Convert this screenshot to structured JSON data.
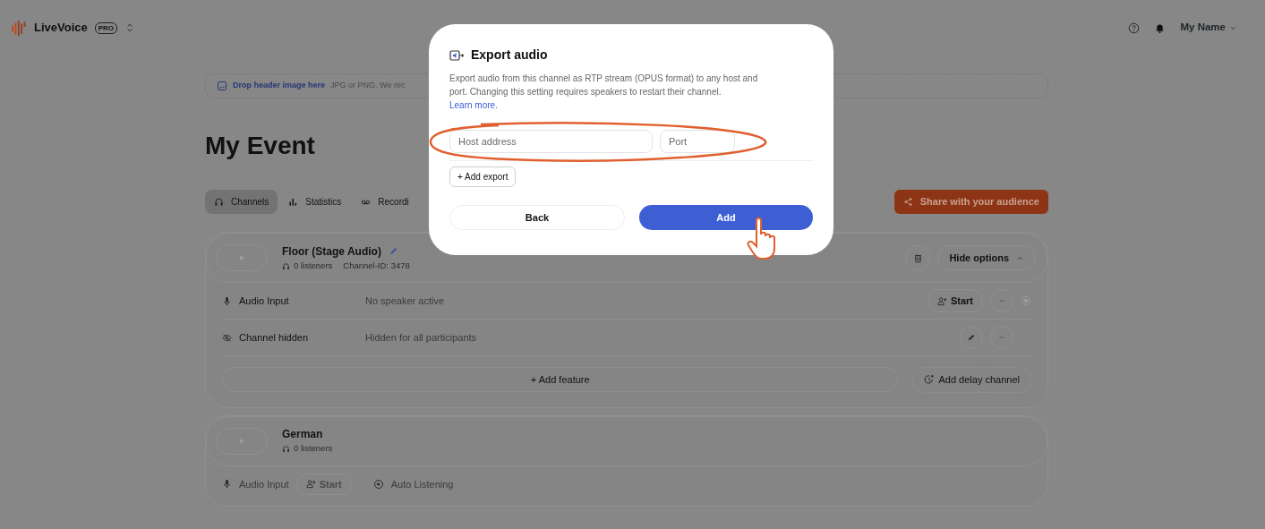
{
  "app": {
    "name": "LiveVoice",
    "badge": "PRO"
  },
  "user": {
    "name": "My Name"
  },
  "drop_zone": {
    "link": "Drop header image here",
    "hint": "JPG or PNG. We rec"
  },
  "title": "My Event",
  "tabs": [
    {
      "kind": "channels",
      "label": "Channels",
      "selected": true
    },
    {
      "kind": "statistics",
      "label": "Statistics",
      "selected": false
    },
    {
      "kind": "recordings",
      "label": "Recordi",
      "selected": false
    }
  ],
  "share_button": "Share with your audience",
  "channels": [
    {
      "name": "Floor (Stage Audio)",
      "listeners": "0 listeners",
      "channel_id": "Channel-ID: 3478",
      "expanded": true,
      "options_button": "Hide options",
      "features": [
        {
          "kind": "audio_input",
          "label": "Audio Input",
          "value": "No speaker active",
          "action": "Start"
        },
        {
          "kind": "hidden",
          "label": "Channel hidden",
          "value": "Hidden for all participants"
        }
      ],
      "add_feature": "+ Add feature",
      "add_delay": "Add delay channel"
    },
    {
      "name": "German",
      "listeners": "0 listeners",
      "expanded": false,
      "input_label": "Audio Input",
      "action": "Start",
      "auto_listening": "Auto Listening"
    }
  ],
  "dialog": {
    "title": "Export audio",
    "description": "Export audio from this channel as RTP stream (OPUS format) to any host and port. Changing this setting requires speakers to restart their channel.",
    "link": "Learn more.",
    "host_placeholder": "Host address",
    "port_placeholder": "Port",
    "add_export": "+ Add export",
    "back": "Back",
    "add": "Add"
  }
}
